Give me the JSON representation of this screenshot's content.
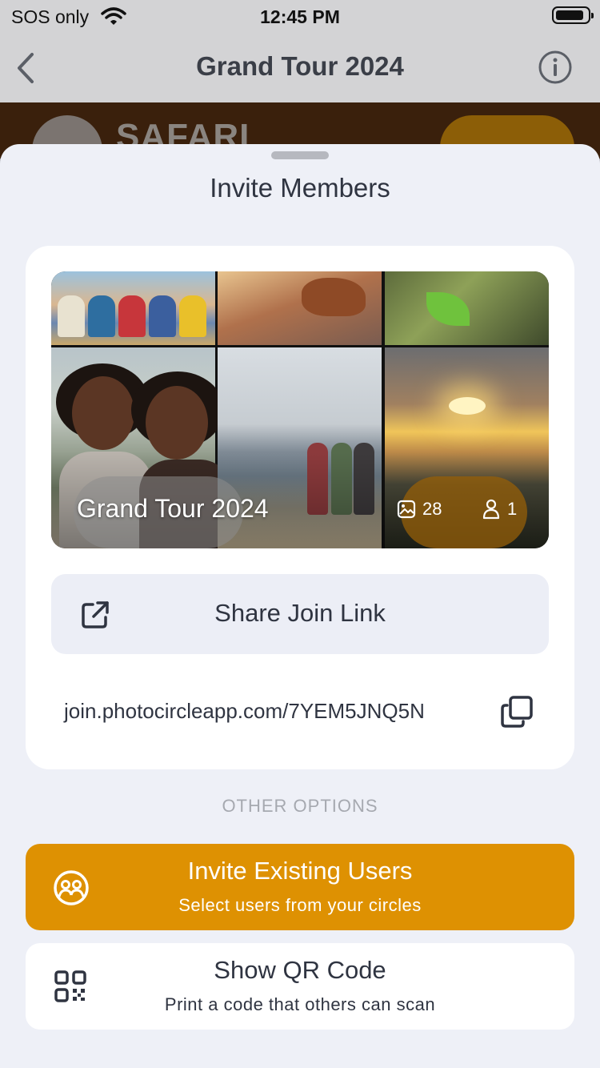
{
  "status_bar": {
    "carrier": "SOS only",
    "time": "12:45 PM",
    "wifi_icon": "wifi-icon",
    "battery_icon": "battery-icon"
  },
  "nav": {
    "title": "Grand Tour 2024",
    "back_icon": "chevron-left-icon",
    "info_icon": "info-icon"
  },
  "banner": {
    "logo_text": "SAFARI"
  },
  "sheet": {
    "title": "Invite Members",
    "circle": {
      "name": "Grand Tour 2024",
      "photo_count": "28",
      "member_count": "1"
    },
    "share": {
      "label": "Share Join Link",
      "icon": "share-external-icon"
    },
    "link": {
      "url": "join.photocircleapp.com/7YEM5JNQ5N",
      "icon": "copy-icon"
    },
    "other_options_label": "OTHER OPTIONS",
    "invite_existing": {
      "title": "Invite Existing Users",
      "subtitle": "Select users from your circles",
      "icon": "users-group-icon",
      "color": "#de9102"
    },
    "qr": {
      "title": "Show QR Code",
      "subtitle": "Print a code that others can scan",
      "icon": "qr-code-icon"
    }
  },
  "colors": {
    "accent": "#de9102",
    "sheet_bg": "#eef0f7",
    "text": "#2f3441"
  }
}
